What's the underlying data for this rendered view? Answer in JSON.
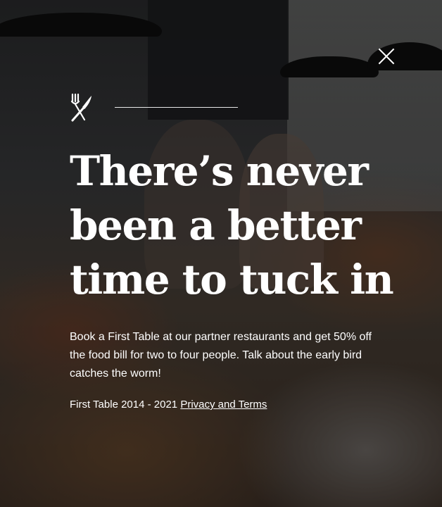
{
  "modal": {
    "close_icon": "close-icon",
    "brand_icon": "fork-knife-icon",
    "headline_lines": [
      "There’s never",
      "been a better",
      "time to tuck in"
    ],
    "body": "Book a First Table at our partner restaurants and get 50% off the food bill for two to four people. Talk about the early bird catches the worm!",
    "footer_text": "First Table 2014 - 2021",
    "privacy_link": "Privacy and Terms"
  }
}
